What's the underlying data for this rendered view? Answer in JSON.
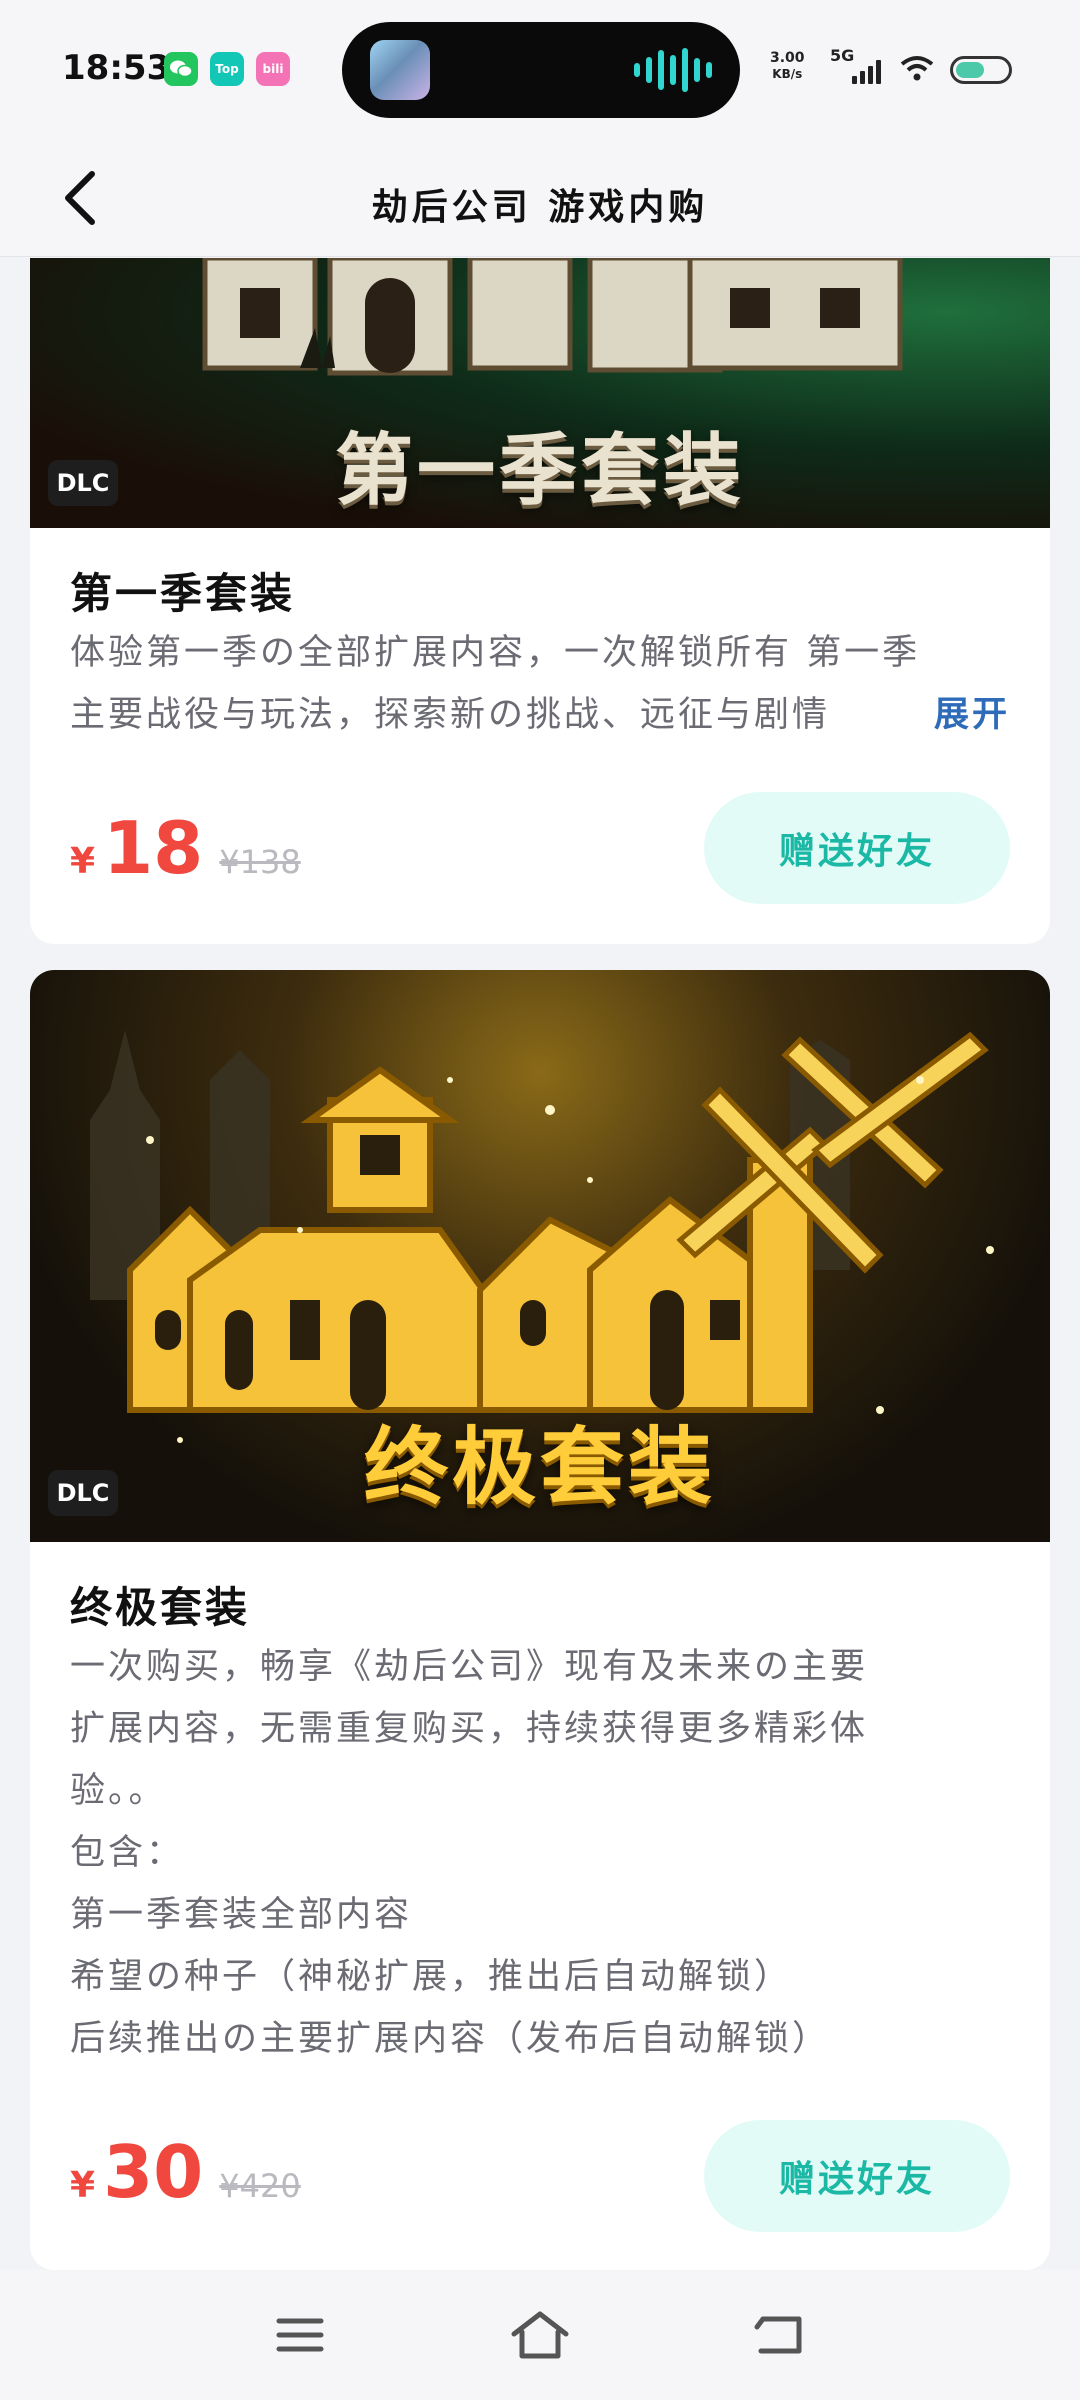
{
  "status_bar": {
    "time": "18:53",
    "apps": [
      {
        "name": "wechat-icon",
        "label": "",
        "color": "#22c55e"
      },
      {
        "name": "toptop-icon",
        "label": "Top",
        "color": "#12c7b5"
      },
      {
        "name": "bilibili-icon",
        "label": "bili",
        "color": "#f472b6"
      }
    ],
    "net_speed_value": "3.00",
    "net_speed_unit": "KB/s",
    "network": "5G"
  },
  "header": {
    "back_icon": "chevron-left-icon",
    "title": "劫后公司 游戏内购"
  },
  "items": [
    {
      "banner_text": "第一季套装",
      "badge": "DLC",
      "title": "第一季套装",
      "description_lines": [
        "体验第一季の全部扩展内容，一次解锁所有 第一季",
        "主要战役与玩法，探索新の挑战、远征与剧情"
      ],
      "expand_label": "展开",
      "currency": "¥",
      "price": "18",
      "original_price": "¥138",
      "gift_label": "赠送好友"
    },
    {
      "banner_text": "终极套装",
      "badge": "DLC",
      "title": "终极套装",
      "description_lines": [
        "一次购买，畅享《劫后公司》现有及未来の主要",
        "扩展内容，无需重复购买，持续获得更多精彩体",
        "验。。",
        "包含：",
        "第一季套装全部内容",
        "希望の种子（神秘扩展，推出后自动解锁）",
        "后续推出の主要扩展内容（发布后自动解锁）"
      ],
      "currency": "¥",
      "price": "30",
      "original_price": "¥420",
      "gift_label": "赠送好友"
    }
  ],
  "nav_bar": {
    "menu_icon": "menu-icon",
    "home_icon": "home-icon",
    "back_icon": "back-icon"
  },
  "colors": {
    "price": "#f0473f",
    "gift_text": "#1bb9a5",
    "gift_bg": "#e2fbf6",
    "expand": "#2e6bb8"
  }
}
